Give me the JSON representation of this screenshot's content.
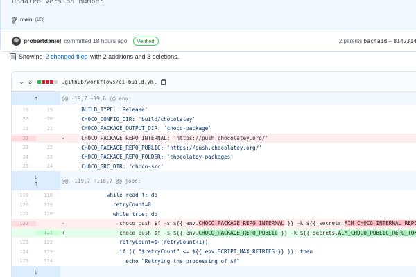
{
  "commit": {
    "message": "Updated version number",
    "branch": "main",
    "pr": "(#3)",
    "author": "probertdaniel",
    "action": "committed 18 hours ago",
    "verified": "Verified",
    "parents_label": "2 parents",
    "parent1": "bac4a1d",
    "plus": "+",
    "parent2": "8142314"
  },
  "summary": {
    "prefix": "Showing",
    "changed": "2 changed files",
    "suffix": "with 2 additions and 3 deletions."
  },
  "file": {
    "changes": "3",
    "path": ".github/workflows/ci-build.yml",
    "diffstat": [
      "g",
      "r",
      "r",
      "r",
      "n"
    ]
  },
  "hunk1": {
    "header": "@@ -19,7 +19,6 @@ env:"
  },
  "lines1": [
    {
      "type": "ctx",
      "old": "19",
      "new": "19",
      "sign": "",
      "code": "    BUILD_TYPE: 'Release'"
    },
    {
      "type": "ctx",
      "old": "20",
      "new": "20",
      "sign": "",
      "code": "    CHOCO_CONFIG_DIR: 'build/chocolatey'"
    },
    {
      "type": "ctx",
      "old": "21",
      "new": "21",
      "sign": "",
      "code": "    CHOCO_PACKAGE_OUTPUT_DIR: 'choco-package'"
    },
    {
      "type": "del",
      "old": "22",
      "new": "",
      "sign": "-",
      "code": "    CHOCO_PACKAGE_REPO_INTERNAL: 'https://push.chocolatey.org/'"
    },
    {
      "type": "ctx",
      "old": "23",
      "new": "22",
      "sign": "",
      "code": "    CHOCO_PACKAGE_REPO_PUBLIC: 'https://push.chocolatey.org/'"
    },
    {
      "type": "ctx",
      "old": "24",
      "new": "23",
      "sign": "",
      "code": "    CHOCO_PACKAGE_REPO_FOLDER: 'chocolatey-packages'"
    },
    {
      "type": "ctx",
      "old": "25",
      "new": "24",
      "sign": "",
      "code": "    CHOCO_SRC_DIR: 'choco-src'"
    }
  ],
  "hunk2": {
    "header": "@@ -119,7 +118,7 @@ jobs:"
  },
  "lines2": {
    "l1": {
      "old": "119",
      "new": "118",
      "code": "            while read f; do"
    },
    "l2": {
      "old": "120",
      "new": "119",
      "code": "              retryCount=0"
    },
    "l3": {
      "old": "121",
      "new": "120",
      "code": "              while true; do"
    },
    "l4": {
      "old": "122",
      "sign": "-",
      "pre": "                choco push $f -s ${{ env.",
      "hl1": "CHOCO_PACKAGE_REPO_INTERNAL",
      "mid": " }} -k ${{ secrets.",
      "hl2": "AIM_CHOCO_INTERNAL_REPO_TOKEN",
      "post": " }}"
    },
    "l5": {
      "new": "121",
      "sign": "+",
      "pre": "                choco push $f -s ${{ env.",
      "hl1": "CHOCO_PACKAGE_REPO_PUBLIC",
      "mid": " }} -k ${{ secrets.",
      "hl2": "AIM_CHOCO_PUBLIC_REPO_TOKEN",
      "post": " }} &&"
    },
    "l6": {
      "old": "123",
      "new": "122",
      "code": "                retryCount=$((retryCount+1))"
    },
    "l7": {
      "old": "124",
      "new": "123",
      "code": "                if (( \"$retryCount\" <= ${{ env.SCRIPT_MAX_RETRIES }} )); then"
    },
    "l8": {
      "old": "125",
      "new": "124",
      "code": "                  echo \"Retrying the processing of $f\""
    }
  },
  "icons": {
    "expand_up": "⭡",
    "expand_down": "⭣",
    "collapse": "⌄",
    "copy": "copy-icon",
    "branch": "branch-icon"
  },
  "colors": {
    "add_bg": "#e6ffed",
    "del_bg": "#ffeef0",
    "verified": "#22863a",
    "link": "#0366d6"
  }
}
